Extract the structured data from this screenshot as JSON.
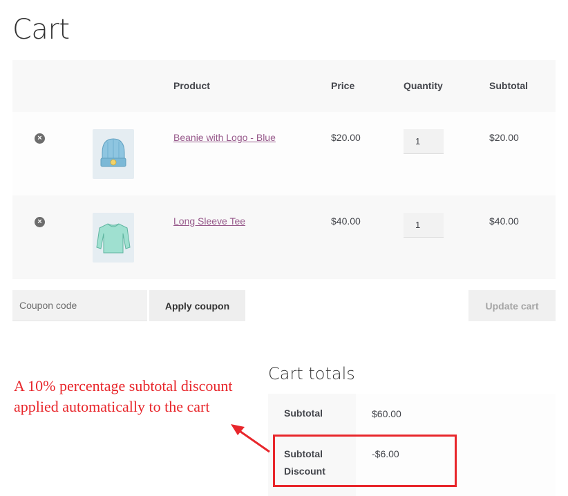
{
  "page": {
    "title": "Cart"
  },
  "cart": {
    "headers": {
      "product": "Product",
      "price": "Price",
      "quantity": "Quantity",
      "subtotal": "Subtotal"
    },
    "items": [
      {
        "name": "Beanie with Logo - Blue",
        "price": "$20.00",
        "quantity": "1",
        "subtotal": "$20.00",
        "remove": "×",
        "thumb_icon": "beanie-thumbnail"
      },
      {
        "name": "Long Sleeve Tee",
        "price": "$40.00",
        "quantity": "1",
        "subtotal": "$40.00",
        "remove": "×",
        "thumb_icon": "long-sleeve-tee-thumbnail"
      }
    ]
  },
  "actions": {
    "coupon_placeholder": "Coupon code",
    "apply_coupon": "Apply coupon",
    "update_cart": "Update cart"
  },
  "totals": {
    "title": "Cart totals",
    "rows": [
      {
        "label": "Subtotal",
        "value": "$60.00"
      },
      {
        "label": "Subtotal Discount",
        "value": "-$6.00"
      }
    ]
  },
  "annotation": {
    "text": "A 10% percentage subtotal discount applied automatically to the cart",
    "color": "#e8262b"
  },
  "colors": {
    "link": "#96588a",
    "table_header_bg": "#f8f8f8",
    "button_bg": "#eeeeee"
  }
}
